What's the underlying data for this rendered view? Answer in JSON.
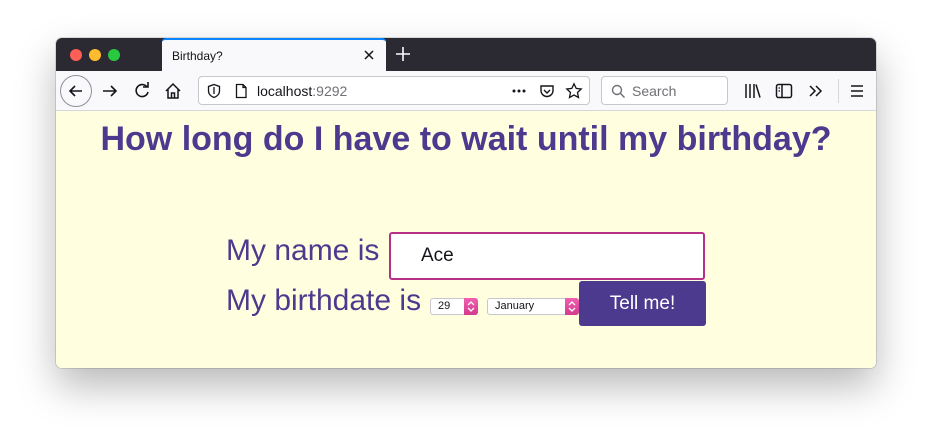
{
  "browser": {
    "tab_title": "Birthday?",
    "url_host": "localhost",
    "url_port": ":9292",
    "search_placeholder": "Search"
  },
  "page": {
    "heading": "How long do I have to wait until my birthday?",
    "name_label": "My name is",
    "name_value": "Ace",
    "birthdate_label": "My birthdate is",
    "day_value": "29",
    "month_value": "January",
    "submit_label": "Tell me!"
  },
  "colors": {
    "accent": "#4b3a8e",
    "input_border": "#b5308a",
    "page_background": "#ffffe0",
    "select_arrow": "#e04f9e"
  }
}
